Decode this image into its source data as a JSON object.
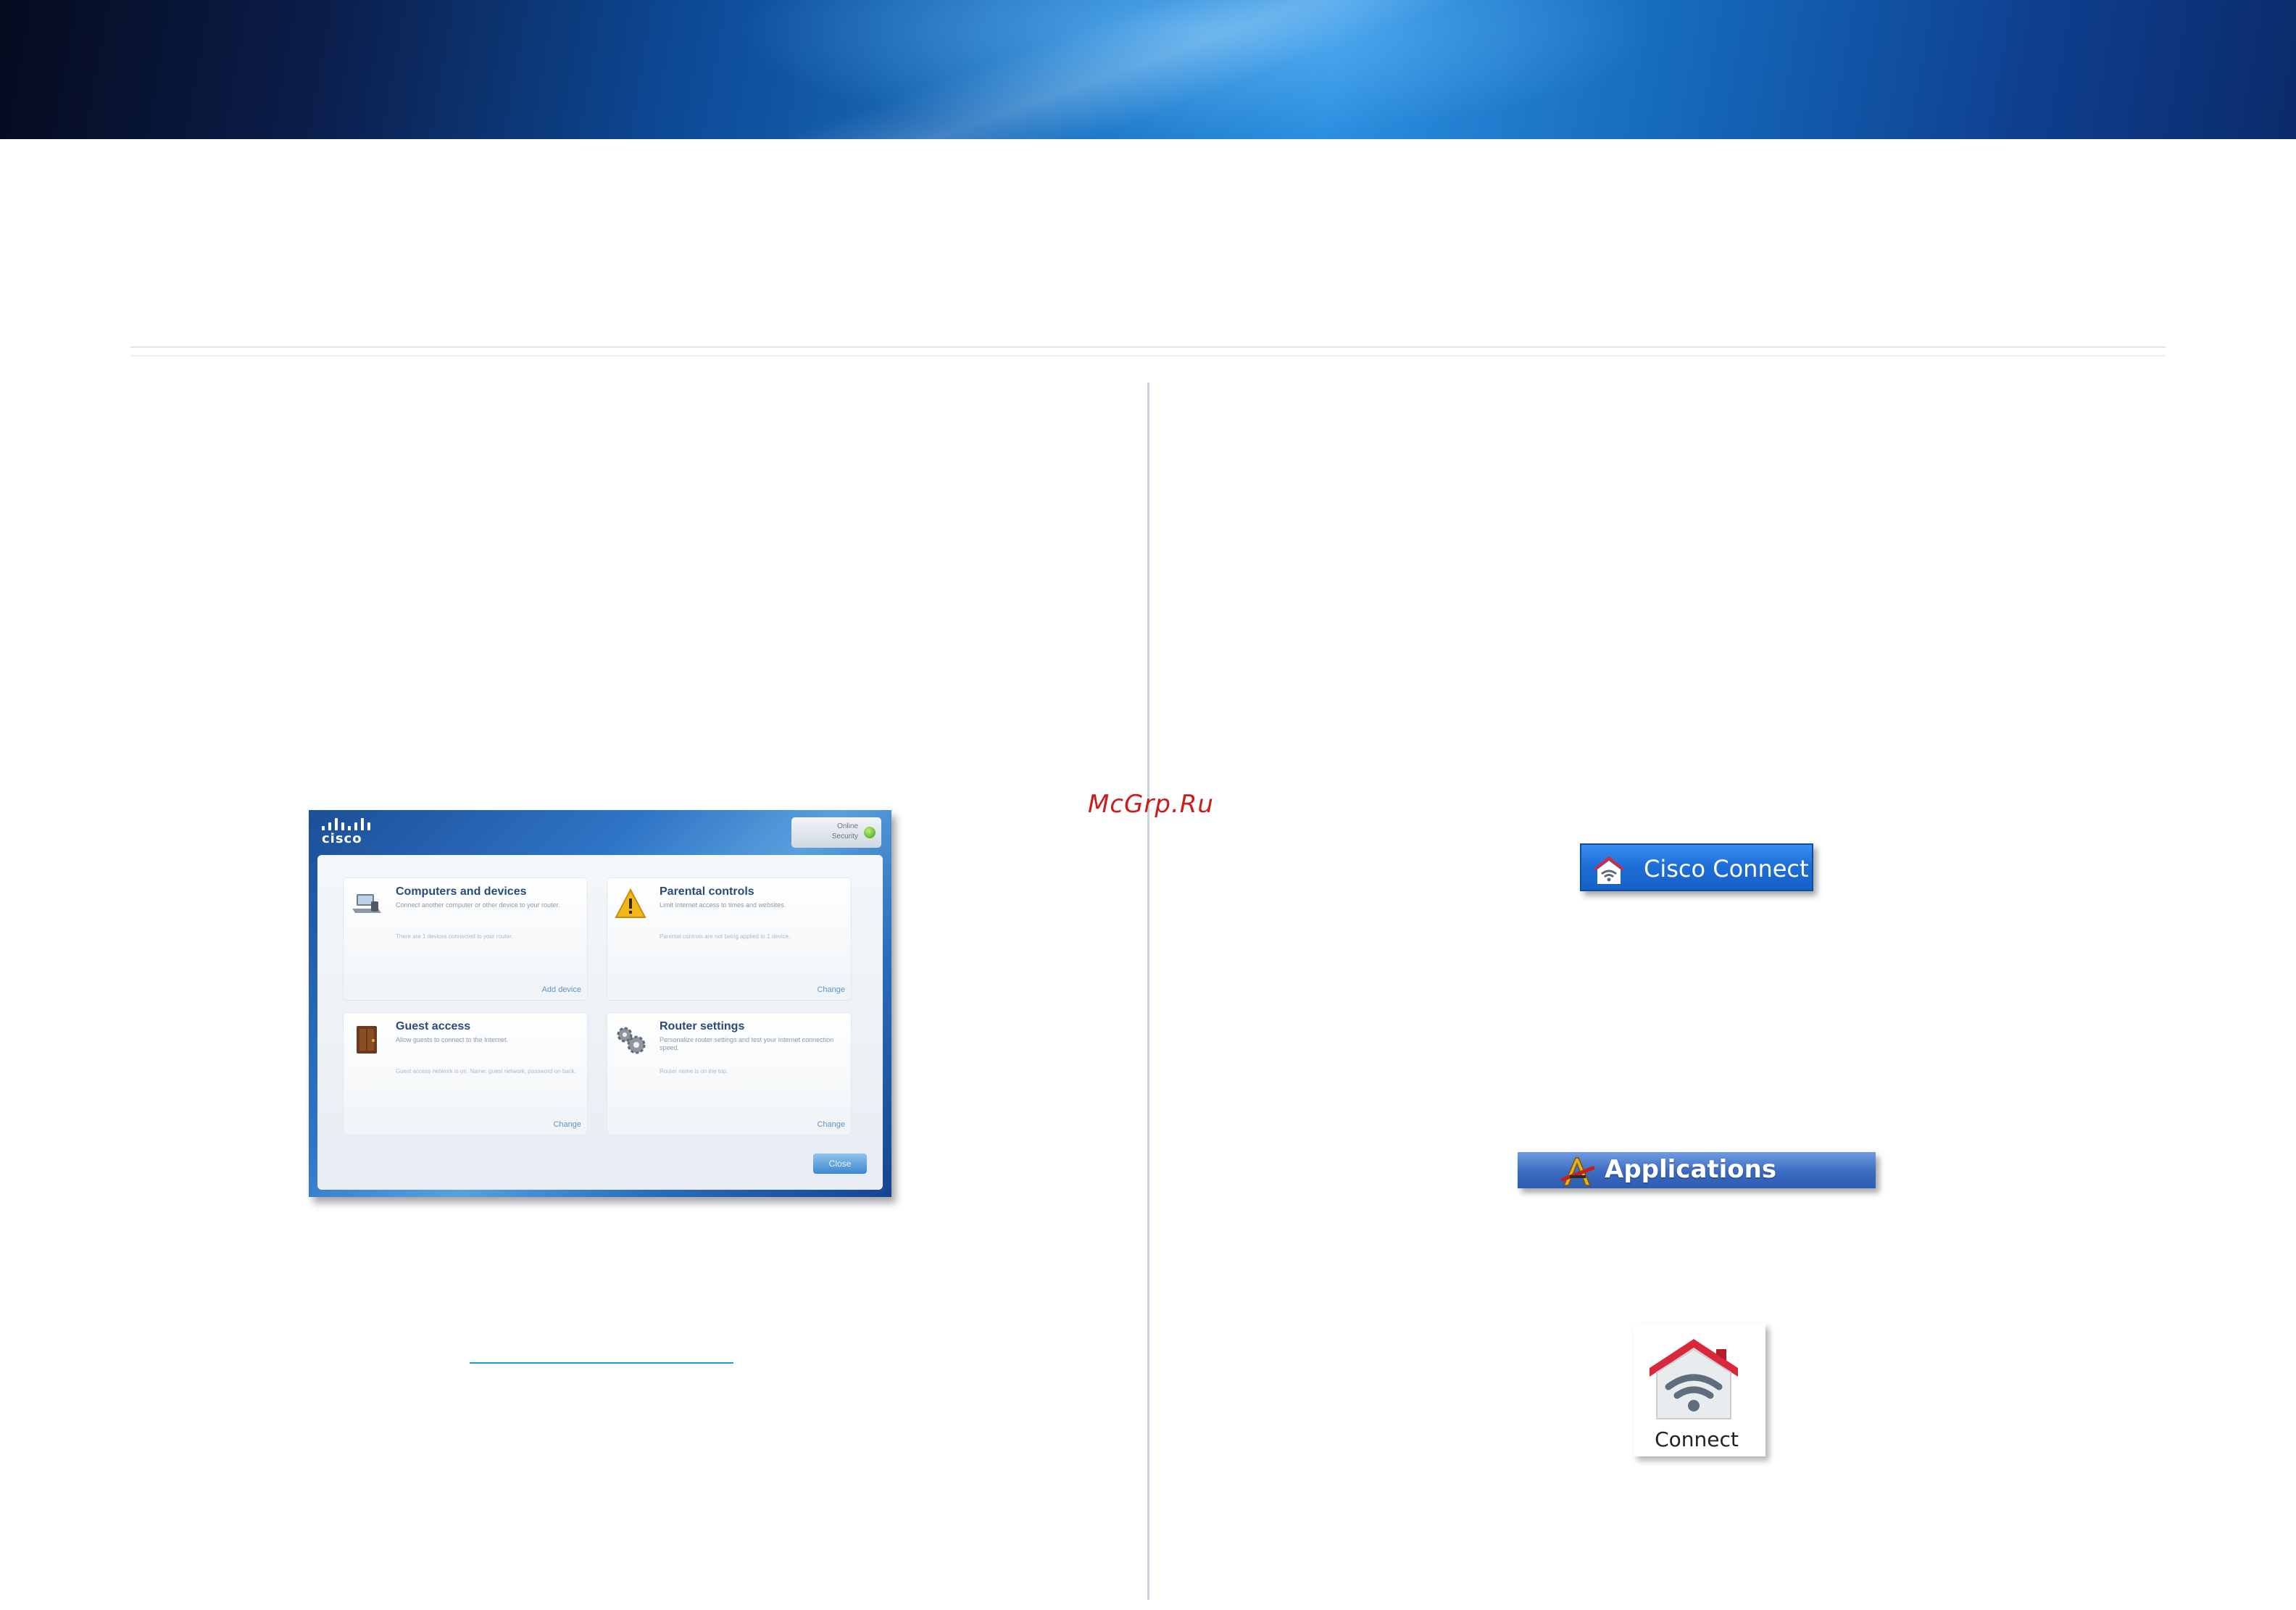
{
  "watermark": "McGrp.Ru",
  "app_window": {
    "logo": "cisco",
    "status_lines": [
      "Online",
      "Security"
    ],
    "tiles": [
      {
        "title": "Computers and devices",
        "desc": "Connect another computer or other device to your router.",
        "sub": "There are 1 devices connected to your router.",
        "link": "Add device",
        "icon": "laptop-icon"
      },
      {
        "title": "Parental controls",
        "desc": "Limit Internet access to times and websites.",
        "sub": "Parental controls are not being applied to 1 device.",
        "link": "Change",
        "icon": "warning-icon"
      },
      {
        "title": "Guest access",
        "desc": "Allow guests to connect to the Internet.",
        "sub": "Guest access network is on. Name: guest network, password on back.",
        "link": "Change",
        "icon": "guest-door-icon"
      },
      {
        "title": "Router settings",
        "desc": "Personalize router settings and test your Internet connection speed.",
        "sub": "Router name is on the top.",
        "link": "Change",
        "icon": "gears-icon"
      }
    ],
    "close_label": "Close"
  },
  "cisco_connect_button": {
    "label": "Cisco Connect",
    "icon": "home-wifi-icon"
  },
  "applications_bar": {
    "label": "Applications",
    "icon": "applications-folder-icon"
  },
  "connect_app": {
    "label": "Connect",
    "icon": "home-wifi-icon"
  },
  "colors": {
    "banner_dark": "#060b1e",
    "banner_blue": "#2b8fe0",
    "button_blue": "#1f6fd9",
    "house_red": "#d8283a",
    "link_cyan": "#1aa0c8"
  }
}
